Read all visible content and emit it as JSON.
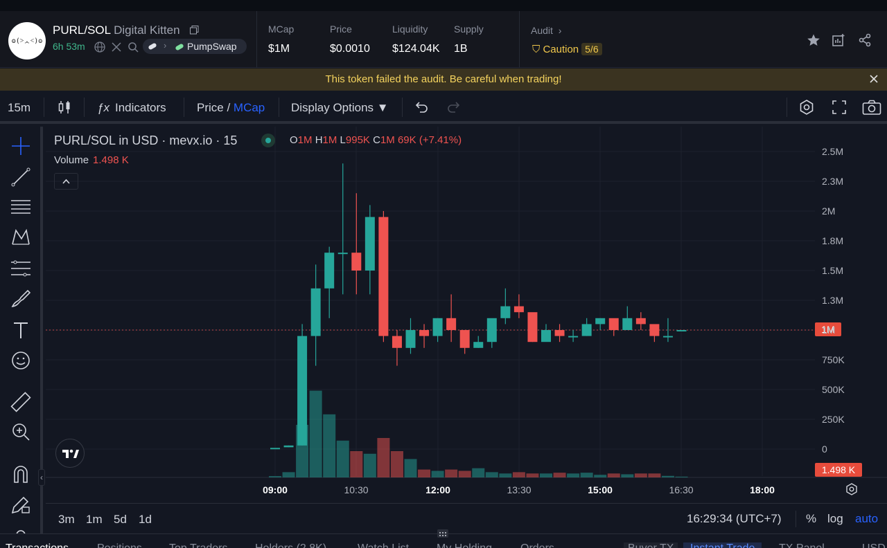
{
  "token": {
    "pair": "PURL/SOL",
    "name": "Digital Kitten",
    "age": "6h 53m",
    "dex": "PumpSwap",
    "logo_text": "ʘ(˃ᆺ˂)ʘ"
  },
  "stats": {
    "mcap_label": "MCap",
    "mcap_value": "$1M",
    "price_label": "Price",
    "price_value": "$0.0010",
    "liquidity_label": "Liquidity",
    "liquidity_value": "$124.04K",
    "supply_label": "Supply",
    "supply_value": "1B"
  },
  "audit": {
    "label": "Audit",
    "status": "Caution",
    "score": "5/6"
  },
  "warning": "This token failed the audit. Be careful when trading!",
  "toolbar": {
    "interval": "15m",
    "indicators": "Indicators",
    "price_label": "Price",
    "slash": " / ",
    "mcap_label": "MCap",
    "display_options": "Display Options ▼"
  },
  "legend": {
    "title": "PURL/SOL in USD · mevx.io · 15",
    "o_label": "O",
    "o_value": "1M",
    "h_label": "H",
    "h_value": "1M",
    "l_label": "L",
    "l_value": "995K",
    "c_label": "C",
    "c_value": "1M",
    "change": "69K (+7.41%)",
    "volume_label": "Volume",
    "volume_value": "1.498 K"
  },
  "price_tag": "1M",
  "volume_tag": "1.498 K",
  "yaxis": [
    "2.5M",
    "2.3M",
    "2M",
    "1.8M",
    "1.5M",
    "1.3M",
    "1M",
    "750K",
    "500K",
    "250K",
    "0"
  ],
  "xaxis": [
    "09:00",
    "10:30",
    "12:00",
    "13:30",
    "15:00",
    "16:30",
    "18:00"
  ],
  "ranges": [
    "3m",
    "1m",
    "5d",
    "1d"
  ],
  "clock": "16:29:34 (UTC+7)",
  "scale": {
    "percent": "%",
    "log": "log",
    "auto": "auto"
  },
  "bottom_tabs": [
    "Transactions",
    "Positions",
    "Top Traders",
    "Holders (2.8K)",
    "Watch List",
    "My Holding",
    "Orders",
    "Buyer TX",
    "Instant Trade",
    "TX Panel",
    "USD"
  ],
  "colors": {
    "up": "#26a69a",
    "down": "#ef5350",
    "accent": "#2962ff",
    "caution": "#f2c94c"
  },
  "chart_data": {
    "type": "candlestick",
    "title": "PURL/SOL in USD · mevx.io · 15",
    "ylim": [
      0,
      2500000
    ],
    "x": [
      "08:45",
      "09:00",
      "09:15",
      "09:30",
      "09:45",
      "10:00",
      "10:15",
      "10:30",
      "10:45",
      "11:00",
      "11:15",
      "11:30",
      "11:45",
      "12:00",
      "12:15",
      "12:30",
      "12:45",
      "13:00",
      "13:15",
      "13:30",
      "13:45",
      "14:00",
      "14:15",
      "14:30",
      "14:45",
      "15:00",
      "15:15",
      "15:30",
      "15:45",
      "16:00",
      "16:15",
      "16:30"
    ],
    "ohlc": [
      [
        10000,
        10000,
        10000,
        10000
      ],
      [
        15000,
        30000,
        15000,
        30000
      ],
      [
        30000,
        1050000,
        30000,
        950000
      ],
      [
        950000,
        1550000,
        700000,
        1350000
      ],
      [
        1350000,
        1700000,
        1100000,
        1650000
      ],
      [
        1650000,
        2400000,
        1300000,
        1650000
      ],
      [
        1650000,
        2150000,
        1300000,
        1500000
      ],
      [
        1500000,
        2050000,
        1300000,
        1950000
      ],
      [
        1950000,
        2000000,
        900000,
        950000
      ],
      [
        950000,
        1000000,
        700000,
        850000
      ],
      [
        850000,
        1100000,
        800000,
        1000000
      ],
      [
        1000000,
        1050000,
        850000,
        950000
      ],
      [
        950000,
        1100000,
        900000,
        1100000
      ],
      [
        1100000,
        1300000,
        900000,
        1000000
      ],
      [
        1000000,
        1000000,
        800000,
        850000
      ],
      [
        850000,
        950000,
        850000,
        900000
      ],
      [
        900000,
        1050000,
        850000,
        1100000
      ],
      [
        1100000,
        1350000,
        1050000,
        1200000
      ],
      [
        1200000,
        1300000,
        1100000,
        1150000
      ],
      [
        1150000,
        1100000,
        900000,
        900000
      ],
      [
        900000,
        1050000,
        950000,
        1000000
      ],
      [
        1000000,
        1050000,
        900000,
        950000
      ],
      [
        950000,
        1000000,
        900000,
        950000
      ],
      [
        950000,
        1100000,
        950000,
        1050000
      ],
      [
        1050000,
        1100000,
        1000000,
        1100000
      ],
      [
        1100000,
        1050000,
        950000,
        1000000
      ],
      [
        1000000,
        1200000,
        1000000,
        1100000
      ],
      [
        1100000,
        1150000,
        1000000,
        1050000
      ],
      [
        1050000,
        1000000,
        900000,
        950000
      ],
      [
        950000,
        1100000,
        900000,
        950000
      ],
      [
        1000000,
        1000000,
        995000,
        1000000
      ]
    ],
    "volume": [
      0.5,
      2,
      20,
      33,
      24,
      14,
      10,
      9,
      15,
      10,
      7,
      3,
      2.5,
      3,
      2.5,
      3.5,
      2,
      1.5,
      2,
      1.5,
      1.5,
      1.8,
      1.5,
      1.8,
      1,
      1.5,
      1.2,
      1.5,
      1.5,
      0.6,
      0.3
    ]
  }
}
